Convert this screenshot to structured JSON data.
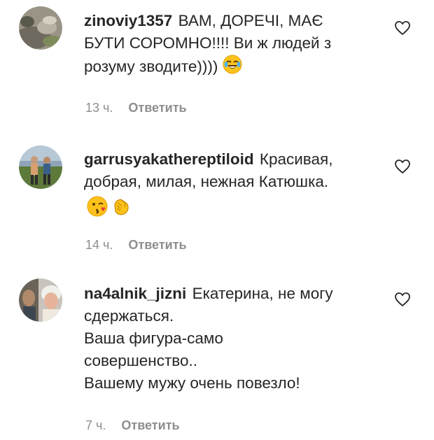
{
  "comments": [
    {
      "username": "zinoviy1357",
      "text": "ВАМ, ДОРЕЧІ, МАЄ\nБУТИ СОРОМНО!!!! Ви ж людей з\nрозуму зводите))))",
      "time": "13 ч.",
      "reply_label": "Ответить",
      "emojis": [
        "joy-emoji"
      ]
    },
    {
      "username": "garrusyakathereptiloid",
      "text": "Красивая,\nдобрая, милая, нежная Катюшка.",
      "time": "14 ч.",
      "reply_label": "Ответить",
      "emojis": [
        "wink-kiss-emoji",
        "clapping-hands-emoji"
      ]
    },
    {
      "username": "na4alnik_jizni",
      "text": "Екатерина, не могу\nсдержаться.\nВаша фигура-само\nсовершенство..\nВашему мужу очень повезло!",
      "time": "7 ч.",
      "reply_label": "Ответить",
      "emojis": []
    }
  ],
  "colors": {
    "text": "#262626",
    "secondary": "#8e8e8e",
    "background": "#ffffff"
  }
}
